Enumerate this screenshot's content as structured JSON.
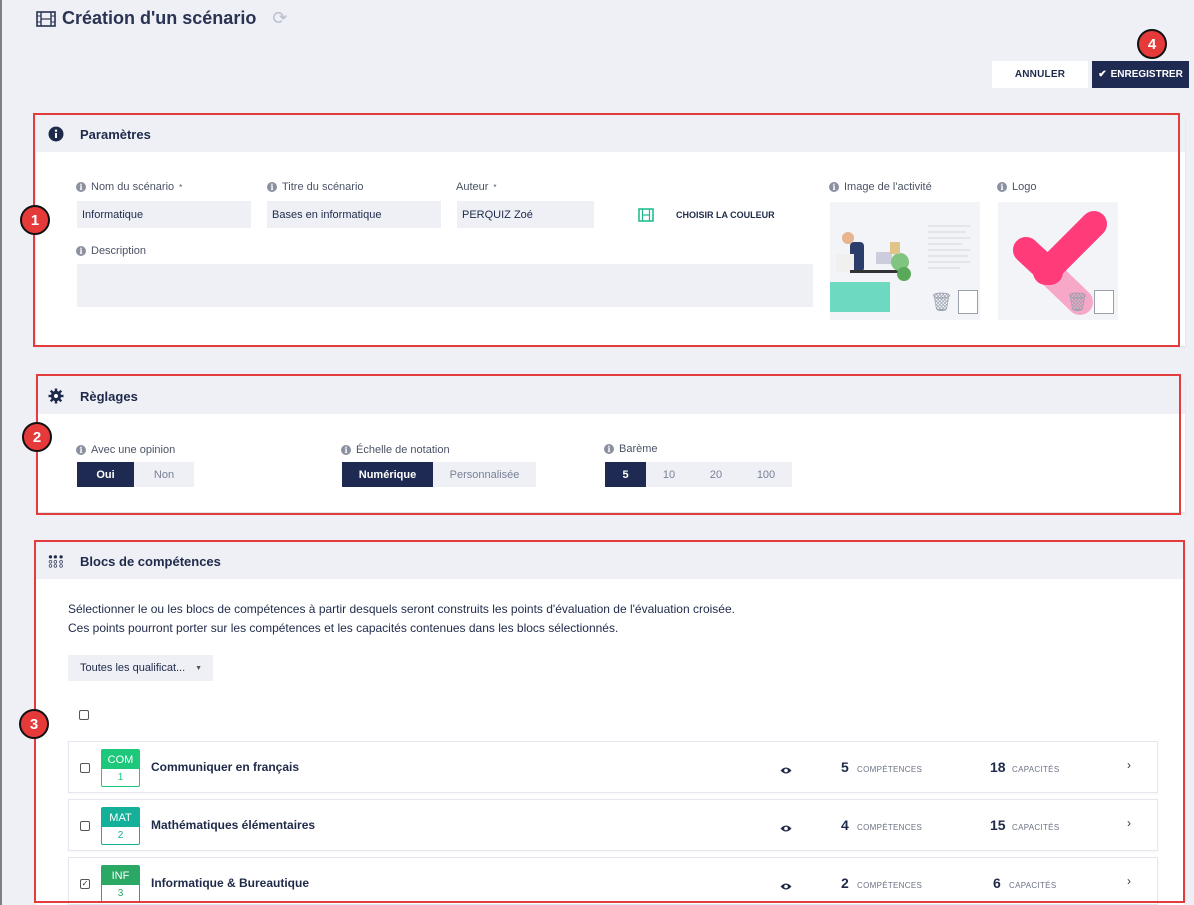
{
  "header": {
    "title": "Création d'un scénario"
  },
  "actions": {
    "cancel": "ANNULER",
    "save": "ENREGISTRER"
  },
  "markers": [
    "1",
    "2",
    "3",
    "4"
  ],
  "parametres": {
    "title": "Paramètres",
    "nom_label": "Nom du scénario",
    "nom_value": "Informatique",
    "titre_label": "Titre du scénario",
    "titre_value": "Bases en informatique",
    "auteur_label": "Auteur",
    "auteur_value": "PERQUIZ Zoé",
    "color_label": "CHOISIR LA COULEUR",
    "image_label": "Image de l'activité",
    "logo_label": "Logo",
    "description_label": "Description",
    "required": "*"
  },
  "reglages": {
    "title": "Règlages",
    "opinion_label": "Avec une opinion",
    "opinion_options": [
      "Oui",
      "Non"
    ],
    "echelle_label": "Échelle de notation",
    "echelle_options": [
      "Numérique",
      "Personnalisée"
    ],
    "bareme_label": "Barème",
    "bareme_options": [
      "5",
      "10",
      "20",
      "100"
    ]
  },
  "blocs": {
    "title": "Blocs de compétences",
    "intro_line1": "Sélectionner le ou les blocs de compétences à partir desquels seront construits les points d'évaluation de l'évaluation croisée.",
    "intro_line2": "Ces points pourront porter sur les compétences et les capacités contenues dans les blocs sélectionnés.",
    "filter": "Toutes les qualificat...",
    "competences_unit": "COMPÉTENCES",
    "capacites_unit": "CAPACITÉS",
    "items": [
      {
        "code": "COM",
        "num": "1",
        "name": "Communiquer en français",
        "competences": "5",
        "capacites": "18",
        "color": "#1ec87a",
        "checked": false
      },
      {
        "code": "MAT",
        "num": "2",
        "name": "Mathématiques élémentaires",
        "competences": "4",
        "capacites": "15",
        "color": "#14b09a",
        "checked": false
      },
      {
        "code": "INF",
        "num": "3",
        "name": "Informatique & Bureautique",
        "competences": "2",
        "capacites": "6",
        "color": "#2aa864",
        "checked": true
      }
    ]
  }
}
